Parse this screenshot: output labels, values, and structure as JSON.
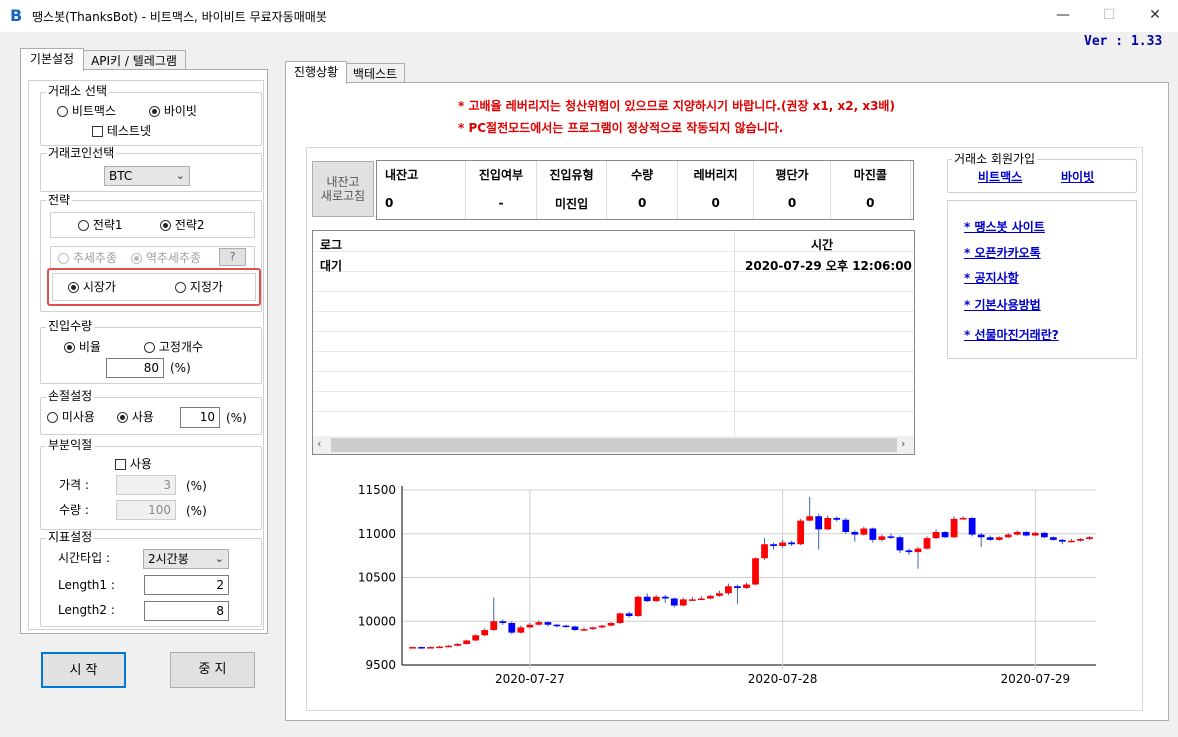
{
  "window": {
    "title": "땡스봇(ThanksBot) - 비트맥스, 바이비트 무료자동매매봇",
    "icon": "B",
    "minimize": "—",
    "maximize": "☐",
    "close": "✕"
  },
  "version": "Ver :  1.33",
  "left_tabs": [
    "기본설정",
    "API키 / 텔레그램"
  ],
  "exchange": {
    "title": "거래소 선택",
    "bitmex": "비트맥스",
    "bybit": "바이빗",
    "testnet": "테스트넷",
    "selected": "바이빗"
  },
  "coin": {
    "title": "거래코인선택",
    "value": "BTC"
  },
  "strategy": {
    "title": "전략",
    "s1": "전략1",
    "s2": "전략2",
    "trend": "추세추종",
    "counter": "역추세추종",
    "help": "?",
    "market": "시장가",
    "limit": "지정가"
  },
  "entry": {
    "title": "진입수량",
    "ratio": "비율",
    "fixed": "고정개수",
    "value": "80",
    "unit": "(%)"
  },
  "stoploss": {
    "title": "손절설정",
    "off": "미사용",
    "on": "사용",
    "value": "10",
    "unit": "(%)"
  },
  "partial": {
    "title": "부분익절",
    "use": "사용",
    "price_label": "가격 :",
    "price_value": "3",
    "qty_label": "수량 :",
    "qty_value": "100",
    "unit": "(%)"
  },
  "indicator": {
    "title": "지표설정",
    "tf_label": "시간타입 :",
    "tf_value": "2시간봉",
    "len1_label": "Length1 :",
    "len1_value": "2",
    "len2_label": "Length2 :",
    "len2_value": "8"
  },
  "buttons": {
    "start": "시 작",
    "stop": "중 지"
  },
  "right_tabs": [
    "진행상황",
    "백테스트"
  ],
  "notes": [
    "* 고배율 레버리지는 청산위험이 있으므로 지양하시기 바랍니다.(권장 x1, x2, x3배)",
    "* PC절전모드에서는 프로그램이 정상적으로 작동되지 않습니다."
  ],
  "refresh_button": {
    "line1": "내잔고",
    "line2": "새로고침"
  },
  "status": {
    "headers": [
      "내잔고",
      "진입여부",
      "진입유형",
      "수량",
      "레버리지",
      "평단가",
      "마진콜"
    ],
    "values": [
      "0",
      "-",
      "미진입",
      "0",
      "0",
      "0",
      "0"
    ]
  },
  "log": {
    "col1": "로그",
    "col2": "시간",
    "rows": [
      {
        "msg": "대기",
        "time": "2020-07-29 오후 12:06:00"
      }
    ]
  },
  "signup": {
    "title": "거래소 회원가입",
    "bitmex": "비트맥스",
    "bybit": "바이빗"
  },
  "links": [
    "* 땡스봇 사이트",
    "* 오픈카카오톡",
    "* 공지사항",
    "* 기본사용방법",
    "* 선물마진거래란?"
  ],
  "chart_data": {
    "type": "candlestick",
    "y_ticks": [
      9500,
      10000,
      10500,
      11000,
      11500
    ],
    "ylim": [
      9500,
      11500
    ],
    "x_ticks": [
      "2020-07-27",
      "2020-07-28",
      "2020-07-29"
    ],
    "colors": {
      "up": "#ff0000",
      "down": "#0000ff",
      "signal": "#ffc000"
    },
    "candles": [
      [
        9700,
        9705,
        9710,
        9695
      ],
      [
        9705,
        9700,
        9710,
        9690
      ],
      [
        9700,
        9705,
        9715,
        9695
      ],
      [
        9705,
        9710,
        9720,
        9700
      ],
      [
        9710,
        9720,
        9730,
        9705
      ],
      [
        9720,
        9740,
        9750,
        9715
      ],
      [
        9740,
        9780,
        9790,
        9735
      ],
      [
        9780,
        9840,
        9850,
        9775
      ],
      [
        9840,
        9900,
        9920,
        9830
      ],
      [
        9900,
        10000,
        10270,
        9890
      ],
      [
        10000,
        9980,
        10020,
        9960
      ],
      [
        9980,
        9870,
        10000,
        9850
      ],
      [
        9870,
        9930,
        9950,
        9860
      ],
      [
        9930,
        9960,
        9980,
        9920
      ],
      [
        9960,
        9990,
        10010,
        9950
      ],
      [
        9990,
        9960,
        10000,
        9940
      ],
      [
        9960,
        9950,
        9970,
        9930
      ],
      [
        9950,
        9940,
        9960,
        9930
      ],
      [
        9940,
        9900,
        9950,
        9890
      ],
      [
        9900,
        9910,
        9930,
        9890
      ],
      [
        9910,
        9930,
        9940,
        9900
      ],
      [
        9930,
        9950,
        9960,
        9920
      ],
      [
        9950,
        9980,
        9990,
        9940
      ],
      [
        9980,
        10090,
        10100,
        9970
      ],
      [
        10090,
        10060,
        10110,
        10040
      ],
      [
        10060,
        10280,
        10290,
        10050
      ],
      [
        10280,
        10230,
        10320,
        10220
      ],
      [
        10230,
        10280,
        10300,
        10220
      ],
      [
        10280,
        10260,
        10300,
        10210
      ],
      [
        10260,
        10180,
        10270,
        10160
      ],
      [
        10180,
        10250,
        10270,
        10170
      ],
      [
        10250,
        10250,
        10280,
        10230
      ],
      [
        10250,
        10260,
        10290,
        10240
      ],
      [
        10260,
        10290,
        10300,
        10250
      ],
      [
        10290,
        10320,
        10350,
        10280
      ],
      [
        10320,
        10400,
        10430,
        10300
      ],
      [
        10400,
        10380,
        10420,
        10200
      ],
      [
        10380,
        10420,
        10440,
        10370
      ],
      [
        10420,
        10720,
        10730,
        10410
      ],
      [
        10720,
        10880,
        10950,
        10700
      ],
      [
        10880,
        10860,
        10900,
        10820
      ],
      [
        10860,
        10900,
        10930,
        10840
      ],
      [
        10900,
        10880,
        10920,
        10860
      ],
      [
        10880,
        11150,
        11170,
        10870
      ],
      [
        11150,
        11200,
        11420,
        11140
      ],
      [
        11200,
        11050,
        11230,
        10820
      ],
      [
        11050,
        11180,
        11210,
        11040
      ],
      [
        11180,
        11160,
        11200,
        11140
      ],
      [
        11160,
        11020,
        11180,
        11000
      ],
      [
        11020,
        10990,
        11040,
        10910
      ],
      [
        10990,
        11060,
        11080,
        10980
      ],
      [
        11060,
        10930,
        11070,
        10900
      ],
      [
        10930,
        10970,
        10990,
        10910
      ],
      [
        10970,
        10960,
        11000,
        10940
      ],
      [
        10960,
        10810,
        10980,
        10780
      ],
      [
        10810,
        10790,
        10830,
        10760
      ],
      [
        10790,
        10830,
        10850,
        10600
      ],
      [
        10830,
        10950,
        10970,
        10820
      ],
      [
        10950,
        11020,
        11050,
        10940
      ],
      [
        11020,
        10960,
        11030,
        10950
      ],
      [
        10960,
        11170,
        11200,
        10950
      ],
      [
        11170,
        11180,
        11200,
        11160
      ],
      [
        11180,
        10990,
        11190,
        10970
      ],
      [
        10990,
        10960,
        11010,
        10850
      ],
      [
        10960,
        10930,
        10980,
        10920
      ],
      [
        10930,
        10960,
        10970,
        10920
      ],
      [
        10960,
        10990,
        11010,
        10950
      ],
      [
        10990,
        11020,
        11040,
        10980
      ],
      [
        11020,
        10980,
        11030,
        10970
      ],
      [
        10980,
        11010,
        11020,
        10970
      ],
      [
        11010,
        10960,
        11020,
        10950
      ],
      [
        10960,
        10930,
        10970,
        10920
      ],
      [
        10930,
        10910,
        10940,
        10880
      ],
      [
        10910,
        10920,
        10940,
        10900
      ],
      [
        10920,
        10940,
        10950,
        10910
      ],
      [
        10940,
        10960,
        10970,
        10930
      ]
    ]
  }
}
